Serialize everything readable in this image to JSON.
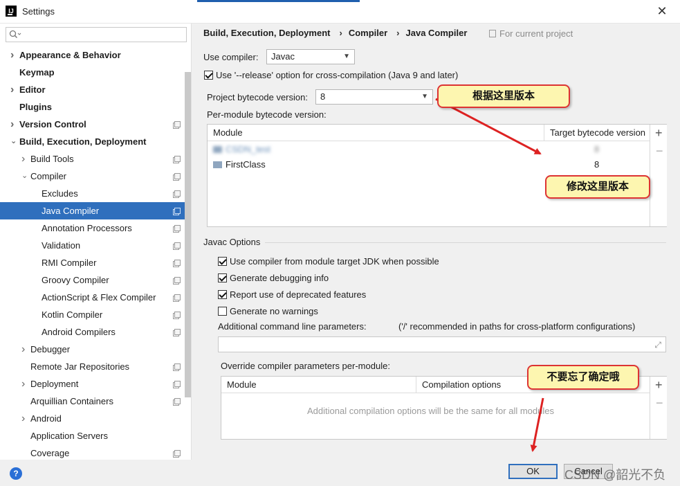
{
  "window": {
    "title": "Settings",
    "app_icon": "IJ",
    "close_glyph": "✕"
  },
  "sidebar": {
    "items": [
      {
        "label": "Appearance & Behavior",
        "bold": true,
        "arrow": "right",
        "level": 0
      },
      {
        "label": "Keymap",
        "bold": true,
        "arrow": "none",
        "level": 0
      },
      {
        "label": "Editor",
        "bold": true,
        "arrow": "right",
        "level": 0
      },
      {
        "label": "Plugins",
        "bold": true,
        "arrow": "none",
        "level": 0
      },
      {
        "label": "Version Control",
        "bold": true,
        "arrow": "right",
        "level": 0,
        "copy": true
      },
      {
        "label": "Build, Execution, Deployment",
        "bold": true,
        "arrow": "down",
        "level": 0
      },
      {
        "label": "Build Tools",
        "arrow": "right",
        "level": 1,
        "copy": true
      },
      {
        "label": "Compiler",
        "arrow": "down",
        "level": 1,
        "copy": true
      },
      {
        "label": "Excludes",
        "level": 2,
        "copy": true
      },
      {
        "label": "Java Compiler",
        "level": 2,
        "copy": true,
        "selected": true
      },
      {
        "label": "Annotation Processors",
        "level": 2,
        "copy": true
      },
      {
        "label": "Validation",
        "level": 2,
        "copy": true
      },
      {
        "label": "RMI Compiler",
        "level": 2,
        "copy": true
      },
      {
        "label": "Groovy Compiler",
        "level": 2,
        "copy": true
      },
      {
        "label": "ActionScript & Flex Compiler",
        "level": 2,
        "copy": true
      },
      {
        "label": "Kotlin Compiler",
        "level": 2,
        "copy": true
      },
      {
        "label": "Android Compilers",
        "level": 2,
        "copy": true
      },
      {
        "label": "Debugger",
        "arrow": "right",
        "level": 1
      },
      {
        "label": "Remote Jar Repositories",
        "level": 1,
        "copy": true
      },
      {
        "label": "Deployment",
        "arrow": "right",
        "level": 1,
        "copy": true
      },
      {
        "label": "Arquillian Containers",
        "level": 1,
        "copy": true
      },
      {
        "label": "Android",
        "arrow": "right",
        "level": 1
      },
      {
        "label": "Application Servers",
        "level": 1
      },
      {
        "label": "Coverage",
        "level": 1,
        "copy": true
      }
    ]
  },
  "breadcrumb": {
    "part1": "Build, Execution, Deployment",
    "part2": "Compiler",
    "part3": "Java Compiler",
    "separator": "›",
    "scope": "For current project"
  },
  "compiler": {
    "use_compiler_label": "Use compiler:",
    "use_compiler_value": "Javac",
    "release_option_label": "Use '--release' option for cross-compilation (Java 9 and later)",
    "release_option_checked": true,
    "project_bytecode_label": "Project bytecode version:",
    "project_bytecode_value": "8",
    "per_module_label": "Per-module bytecode version:"
  },
  "module_table": {
    "col_module": "Module",
    "col_target": "Target bytecode version",
    "rows": [
      {
        "module": "CSDN_test",
        "target": "8",
        "blurred": true
      },
      {
        "module": "FirstClass",
        "target": "8",
        "blurred": false
      }
    ]
  },
  "javac": {
    "section_label": "Javac Options",
    "options": [
      {
        "label": "Use compiler from module target JDK when possible",
        "checked": true
      },
      {
        "label": "Generate debugging info",
        "checked": true
      },
      {
        "label": "Report use of deprecated features",
        "checked": true
      },
      {
        "label": "Generate no warnings",
        "checked": false
      }
    ],
    "additional_label": "Additional command line parameters:",
    "additional_hint": "('/' recommended in paths for cross-platform configurations)",
    "additional_value": "",
    "override_label": "Override compiler parameters per-module:",
    "override_col_module": "Module",
    "override_col_options": "Compilation options",
    "override_empty": "Additional compilation options will be the same for all modules"
  },
  "annotations": {
    "callout1": "根据这里版本",
    "callout2": "修改这里版本",
    "callout3": "不要忘了确定哦",
    "color": "#dd2222"
  },
  "buttons": {
    "ok": "OK",
    "cancel": "Cancel",
    "help": "?"
  },
  "watermark": "CSDN @韶光不负",
  "colors": {
    "selection": "#2f6fbd",
    "callout_fill": "#fdf6b0",
    "callout_border": "#dd3333"
  }
}
